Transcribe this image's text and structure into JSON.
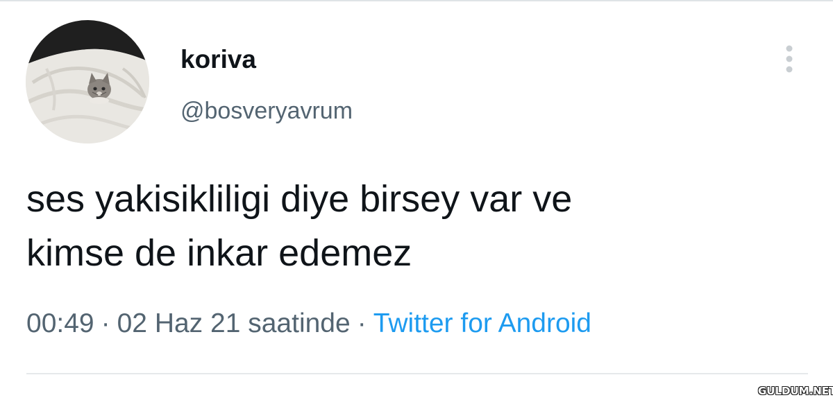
{
  "tweet": {
    "author": {
      "display_name": "koriva",
      "handle": "@bosveryavrum",
      "avatar_icon": "kitten-in-blanket-avatar"
    },
    "text_lines": [
      "ses yakisikliligi diye birsey var ve",
      "kimse de inkar edemez"
    ],
    "meta": {
      "time": "00:49",
      "separator": "·",
      "date": "02 Haz 21 saatinde",
      "source": "Twitter for Android"
    },
    "more_icon": "more-vertical-icon"
  },
  "watermark": {
    "text": "GULDUM.NET"
  },
  "colors": {
    "text_primary": "#0f1419",
    "text_secondary": "#536471",
    "link": "#1d9bf0",
    "divider": "#e6e9eb"
  }
}
